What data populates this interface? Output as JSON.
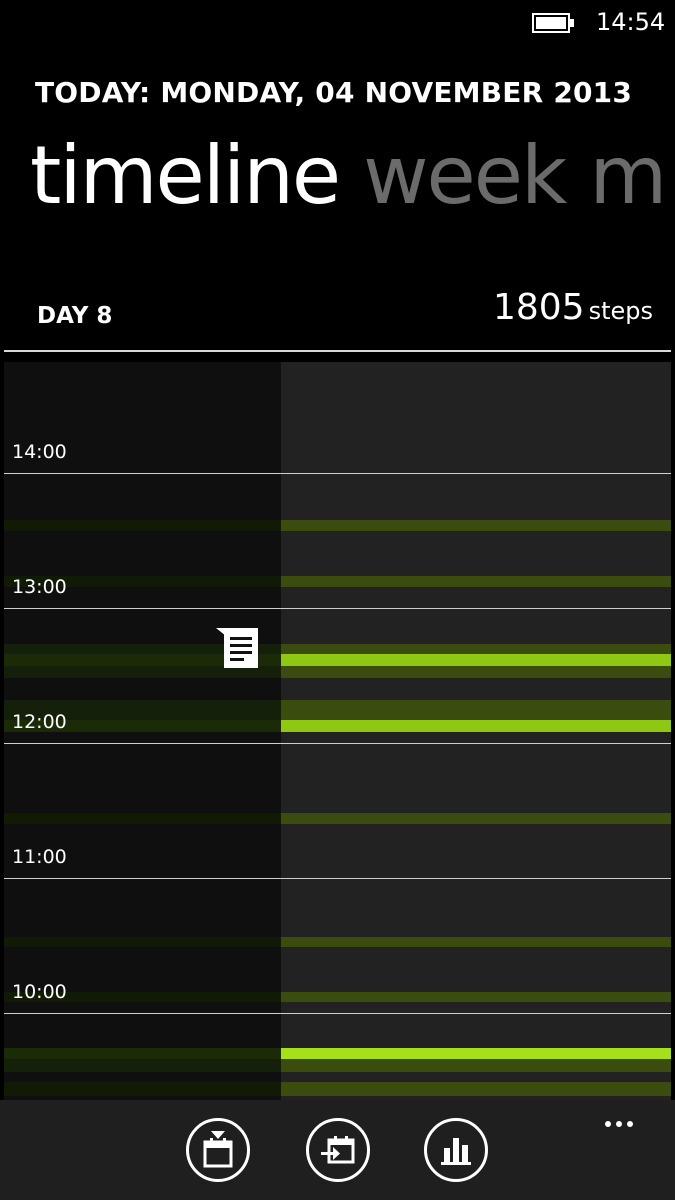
{
  "status_bar": {
    "time": "14:54",
    "battery_icon": "battery-icon"
  },
  "header": {
    "today": "TODAY: MONDAY, 04 NOVEMBER 2013",
    "pivot_tabs": [
      {
        "label": "timeline",
        "active": true
      },
      {
        "label": "week",
        "active": false
      },
      {
        "label": "m",
        "active": false
      }
    ]
  },
  "summary": {
    "day_label": "DAY 8",
    "steps_value": "1805",
    "steps_unit": "steps"
  },
  "timeline": {
    "hours": [
      "14:00",
      "13:00",
      "12:00",
      "11:00",
      "10:00"
    ],
    "note_icon": "note-icon",
    "colors": {
      "left_bg": "#0f0f0f",
      "right_bg": "#222222",
      "activity_dim": "#3a4d0e",
      "activity_bright": "#8fc813",
      "activity_brightest": "#a6e01a"
    }
  },
  "app_bar": {
    "buttons": [
      {
        "name": "calendar-download-icon"
      },
      {
        "name": "calendar-import-icon"
      },
      {
        "name": "bar-chart-icon"
      }
    ],
    "more_icon": "ellipsis-icon"
  }
}
